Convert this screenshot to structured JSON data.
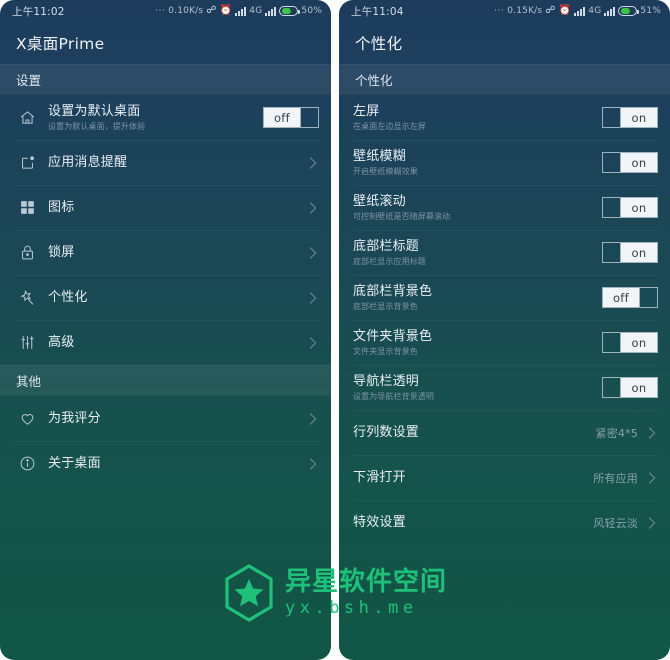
{
  "left": {
    "statusbar": {
      "time": "上午11:02",
      "dots": "···",
      "netspeed": "0.10K/s",
      "bluetooth_icon": "bluetooth-icon",
      "alarm_icon": "alarm-icon",
      "signal_icon": "signal-bars-icon",
      "network_type": "4G",
      "signal2_icon": "signal-bars-icon",
      "battery_icon": "battery-charging-icon",
      "battery": "50%"
    },
    "app_title": "X桌面Prime",
    "sections": [
      {
        "header": "设置",
        "rows": [
          {
            "icon": "home-icon",
            "title": "设置为默认桌面",
            "sub": "设置为默认桌面，提升体验",
            "control": "toggle",
            "toggle_state": "off",
            "toggle_label": "off"
          },
          {
            "icon": "notification-icon",
            "title": "应用消息提醒",
            "sub": "",
            "control": "chevron"
          },
          {
            "icon": "grid-icon",
            "title": "图标",
            "sub": "",
            "control": "chevron"
          },
          {
            "icon": "lock-icon",
            "title": "锁屏",
            "sub": "",
            "control": "chevron"
          },
          {
            "icon": "magic-wand-icon",
            "title": "个性化",
            "sub": "",
            "control": "chevron"
          },
          {
            "icon": "sliders-icon",
            "title": "高级",
            "sub": "",
            "control": "chevron"
          }
        ]
      },
      {
        "header": "其他",
        "rows": [
          {
            "icon": "heart-icon",
            "title": "为我评分",
            "sub": "",
            "control": "chevron"
          },
          {
            "icon": "info-icon",
            "title": "关于桌面",
            "sub": "",
            "control": "chevron"
          }
        ]
      }
    ]
  },
  "right": {
    "statusbar": {
      "time": "上午11:04",
      "dots": "···",
      "netspeed": "0.15K/s",
      "bluetooth_icon": "bluetooth-icon",
      "alarm_icon": "alarm-icon",
      "signal_icon": "signal-bars-icon",
      "network_type": "4G",
      "signal2_icon": "signal-bars-icon",
      "battery_icon": "battery-charging-icon",
      "battery": "51%"
    },
    "app_title": "个性化",
    "sections": [
      {
        "header": "个性化",
        "rows": [
          {
            "title": "左屏",
            "sub": "在桌面左边显示左屏",
            "control": "toggle",
            "toggle_state": "on",
            "toggle_label": "on"
          },
          {
            "title": "壁纸模糊",
            "sub": "开启壁纸模糊效果",
            "control": "toggle",
            "toggle_state": "on",
            "toggle_label": "on"
          },
          {
            "title": "壁纸滚动",
            "sub": "可控制壁纸是否随屏幕滚动",
            "control": "toggle",
            "toggle_state": "on",
            "toggle_label": "on"
          },
          {
            "title": "底部栏标题",
            "sub": "底部栏显示应用标题",
            "control": "toggle",
            "toggle_state": "on",
            "toggle_label": "on"
          },
          {
            "title": "底部栏背景色",
            "sub": "底部栏显示背景色",
            "control": "toggle",
            "toggle_state": "off",
            "toggle_label": "off"
          },
          {
            "title": "文件夹背景色",
            "sub": "文件夹显示背景色",
            "control": "toggle",
            "toggle_state": "on",
            "toggle_label": "on"
          },
          {
            "title": "导航栏透明",
            "sub": "设置为导航栏背景透明",
            "control": "toggle",
            "toggle_state": "on",
            "toggle_label": "on"
          },
          {
            "title": "行列数设置",
            "sub": "",
            "control": "value",
            "value": "紧密4*5"
          },
          {
            "title": "下滑打开",
            "sub": "",
            "control": "value",
            "value": "所有应用"
          },
          {
            "title": "特效设置",
            "sub": "",
            "control": "value",
            "value": "风轻云淡"
          }
        ]
      }
    ]
  },
  "watermark": {
    "logo_icon": "hexagon-star-icon",
    "name": "异星软件空间",
    "url": "yx.bsh.me",
    "color": "#1fc07a"
  }
}
